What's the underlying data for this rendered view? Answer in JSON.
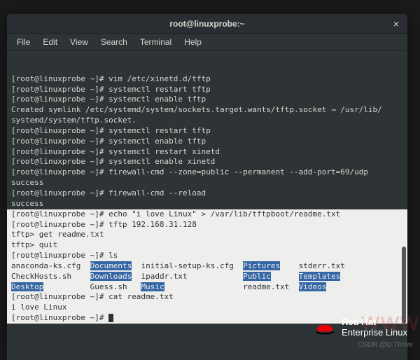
{
  "window": {
    "title": "root@linuxprobe:~",
    "close_glyph": "×"
  },
  "menubar": {
    "items": [
      "File",
      "Edit",
      "View",
      "Search",
      "Terminal",
      "Help"
    ]
  },
  "prompt": "[root@linuxprobe ~]#",
  "tftp_prompt": "tftp>",
  "dark_lines": {
    "l1_cmd": " vim /etc/xinetd.d/tftp",
    "l2_cmd": " systemctl restart tftp",
    "l3_cmd": " systemctl enable tftp",
    "l4": "Created symlink /etc/systemd/system/sockets.target.wants/tftp.socket → /usr/lib/",
    "l5": "systemd/system/tftp.socket.",
    "l6_cmd": " systemctl restart tftp",
    "l7_cmd": " systemctl enable tftp",
    "l8_cmd": " systemctl restart xinetd",
    "l9_cmd": " systemctl enable xinetd",
    "l10_cmd": " firewall-cmd --zone=public --permanent --add-port=69/udp",
    "l11": "success",
    "l12_cmd": " firewall-cmd --reload",
    "l13": "success"
  },
  "light_lines": {
    "l1_cmd": " echo \"i love Linux\" > /var/lib/tftpboot/readme.txt",
    "l2_cmd": " tftp 192.168.31.128",
    "l3": " get readme.txt",
    "l4": " quit",
    "l5_cmd": " ls",
    "l9_cmd": " cat readme.txt",
    "l10": "i love Linux",
    "l11_cmd": " "
  },
  "ls_output": {
    "row1": {
      "c1": "anaconda-ks.cfg",
      "c2": "Documents",
      "c3": "initial-setup-ks.cfg",
      "c4": "Pictures",
      "c5": "stderr.txt"
    },
    "row2": {
      "c1": "CheckHosts.sh",
      "c2": "Downloads",
      "c3": "ipaddr.txt",
      "c4": "Public",
      "c5": "Templates"
    },
    "row3": {
      "c1": "Desktop",
      "c2": "Guess.sh",
      "c3": "Music",
      "c4": "readme.txt",
      "c5": "Videos"
    }
  },
  "branding": {
    "redhat_bold": "Red Hat",
    "redhat_sub": "Enterprise Linux",
    "csdn": "CSDN @D.Thrive",
    "watermark": "www"
  }
}
